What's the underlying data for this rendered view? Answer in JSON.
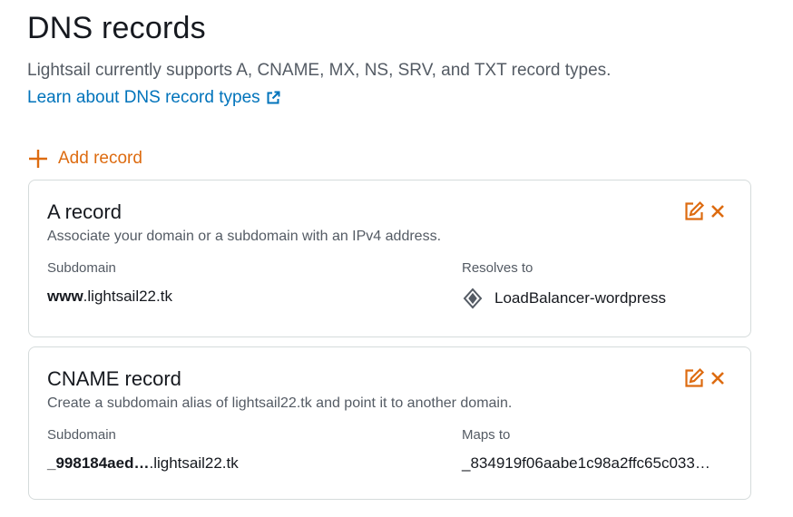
{
  "header": {
    "title": "DNS records",
    "subtitle": "Lightsail currently supports A, CNAME, MX, NS, SRV, and TXT record types.",
    "learn_link": "Learn about DNS record types"
  },
  "add_record_label": "Add record",
  "records": [
    {
      "title": "A record",
      "description": "Associate your domain or a subdomain with an IPv4 address.",
      "left_label": "Subdomain",
      "left_value_bold": "www",
      "left_value_rest": ".lightsail22.tk",
      "right_label": "Resolves to",
      "right_value": "LoadBalancer-wordpress"
    },
    {
      "title": "CNAME record",
      "description": "Create a subdomain alias of lightsail22.tk and point it to another domain.",
      "left_label": "Subdomain",
      "left_value_bold": "_998184aed…",
      "left_value_rest": ".lightsail22.tk",
      "right_label": "Maps to",
      "right_value": "_834919f06aabe1c98a2ffc65c033…"
    }
  ],
  "colors": {
    "accent": "#dd6b10",
    "link": "#0073bb",
    "text": "#16191f",
    "muted": "#545b64",
    "border": "#d5dbdb"
  },
  "icons": {
    "external_link": "external-link-icon",
    "add": "plus-icon",
    "edit": "edit-icon",
    "delete": "close-icon",
    "load_balancer": "load-balancer-icon"
  }
}
